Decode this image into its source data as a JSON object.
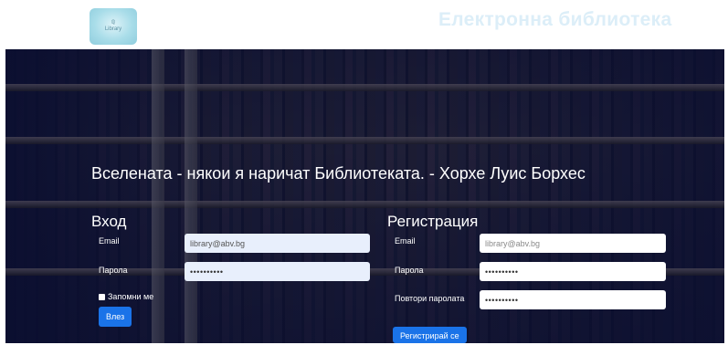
{
  "header": {
    "logo_text_top": "ℚ",
    "logo_text": "Library",
    "title": "Електронна библиотека"
  },
  "hero": {
    "quote": "Вселената - някои я наричат Библиотеката. - Хорхе Луис Борхес"
  },
  "login": {
    "title": "Вход",
    "email_label": "Email",
    "email_value": "library@abv.bg",
    "password_label": "Парола",
    "password_value": "••••••••••",
    "remember_label": "Запомни ме",
    "submit_label": "Влез"
  },
  "register": {
    "title": "Регистрация",
    "email_label": "Email",
    "email_placeholder": "library@abv.bg",
    "password_label": "Парола",
    "password_value": "••••••••••",
    "confirm_label": "Повтори паролата",
    "confirm_value": "••••••••••",
    "submit_label": "Регистрирай се"
  }
}
